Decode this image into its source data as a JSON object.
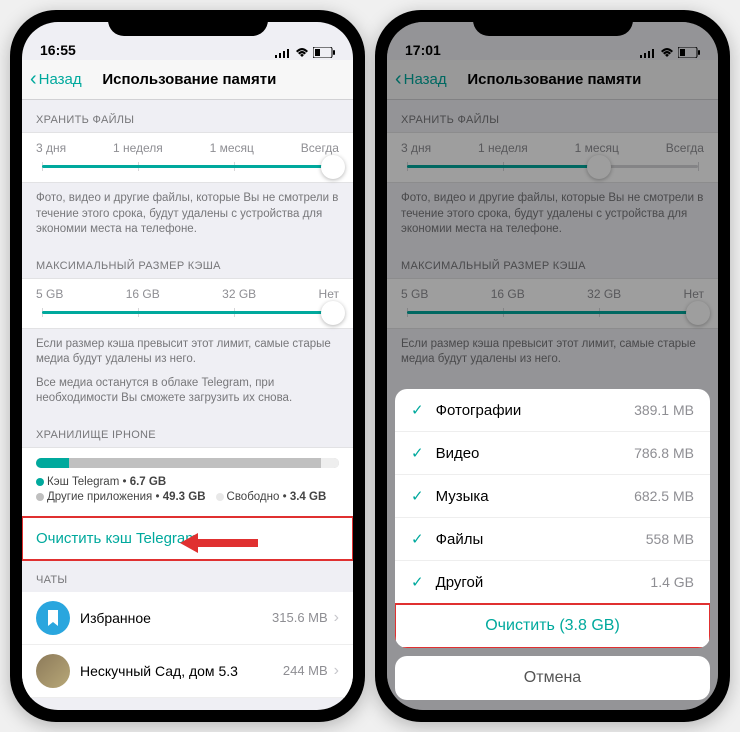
{
  "left": {
    "time": "16:55",
    "back": "Назад",
    "title": "Использование памяти",
    "sec_keep": "ХРАНИТЬ ФАЙЛЫ",
    "keep_opts": [
      "3 дня",
      "1 неделя",
      "1 месяц",
      "Всегда"
    ],
    "keep_note": "Фото, видео и другие файлы, которые Вы не смотрели в течение этого срока, будут удалены с устройства для экономии места на телефоне.",
    "sec_cache": "МАКСИМАЛЬНЫЙ РАЗМЕР КЭША",
    "cache_opts": [
      "5 GB",
      "16 GB",
      "32 GB",
      "Нет"
    ],
    "cache_note1": "Если размер кэша превысит этот лимит, самые старые медиа будут удалены из него.",
    "cache_note2": "Все медиа останутся в облаке Telegram, при необходимости Вы сможете загрузить их снова.",
    "sec_storage": "ХРАНИЛИЩЕ IPHONE",
    "legend_cache": "Кэш Telegram",
    "legend_cache_val": "6.7 GB",
    "legend_other": "Другие приложения",
    "legend_other_val": "49.3 GB",
    "legend_free": "Свободно",
    "legend_free_val": "3.4 GB",
    "clear_cache": "Очистить кэш Telegram",
    "sec_chats": "ЧАТЫ",
    "chat1_name": "Избранное",
    "chat1_size": "315.6 MB",
    "chat2_name": "Нескучный Сад, дом 5.3",
    "chat2_size": "244 MB"
  },
  "right": {
    "time": "17:01",
    "back": "Назад",
    "title": "Использование памяти",
    "sec_keep": "ХРАНИТЬ ФАЙЛЫ",
    "keep_opts": [
      "3 дня",
      "1 неделя",
      "1 месяц",
      "Всегда"
    ],
    "keep_note": "Фото, видео и другие файлы, которые Вы не смотрели в течение этого срока, будут удалены с устройства для экономии места на телефоне.",
    "sec_cache": "МАКСИМАЛЬНЫЙ РАЗМЕР КЭША",
    "cache_opts": [
      "5 GB",
      "16 GB",
      "32 GB",
      "Нет"
    ],
    "cache_note1": "Если размер кэша превысит этот лимит, самые старые медиа будут удалены из него.",
    "sheet": {
      "rows": [
        {
          "label": "Фотографии",
          "value": "389.1 MB"
        },
        {
          "label": "Видео",
          "value": "786.8 MB"
        },
        {
          "label": "Музыка",
          "value": "682.5 MB"
        },
        {
          "label": "Файлы",
          "value": "558 MB"
        },
        {
          "label": "Другой",
          "value": "1.4 GB"
        }
      ],
      "clear": "Очистить (3.8 GB)",
      "cancel": "Отмена"
    }
  },
  "colors": {
    "accent": "#00a99d"
  }
}
